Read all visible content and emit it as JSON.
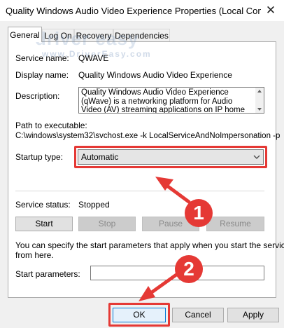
{
  "window": {
    "title": "Quality Windows Audio Video Experience Properties (Local Compu...",
    "close_glyph": "✕"
  },
  "watermark": {
    "main": "driver easy",
    "sub": "www.DriverEasy.com"
  },
  "tabs": [
    {
      "label": "General",
      "active": true
    },
    {
      "label": "Log On",
      "active": false
    },
    {
      "label": "Recovery",
      "active": false
    },
    {
      "label": "Dependencies",
      "active": false
    }
  ],
  "general": {
    "service_name_label": "Service name:",
    "service_name_value": "QWAVE",
    "display_name_label": "Display name:",
    "display_name_value": "Quality Windows Audio Video Experience",
    "description_label": "Description:",
    "description_value": "Quality Windows Audio Video Experience (qWave) is a networking platform for Audio Video (AV) streaming applications on IP home networks. qWave",
    "path_label": "Path to executable:",
    "path_value": "C:\\windows\\system32\\svchost.exe -k LocalServiceAndNoImpersonation -p",
    "startup_type_label": "Startup type:",
    "startup_type_value": "Automatic",
    "service_status_label": "Service status:",
    "service_status_value": "Stopped",
    "start_label": "Start",
    "stop_label": "Stop",
    "pause_label": "Pause",
    "resume_label": "Resume",
    "hint_line1": "You can specify the start parameters that apply when you start the service",
    "hint_line2": "from here.",
    "start_params_label": "Start parameters:",
    "start_params_value": ""
  },
  "footer": {
    "ok_label": "OK",
    "cancel_label": "Cancel",
    "apply_label": "Apply"
  },
  "annotations": {
    "step1": "1",
    "step2": "2"
  },
  "colors": {
    "highlight": "#e53935",
    "dialog_bg": "#f0f0f0"
  }
}
